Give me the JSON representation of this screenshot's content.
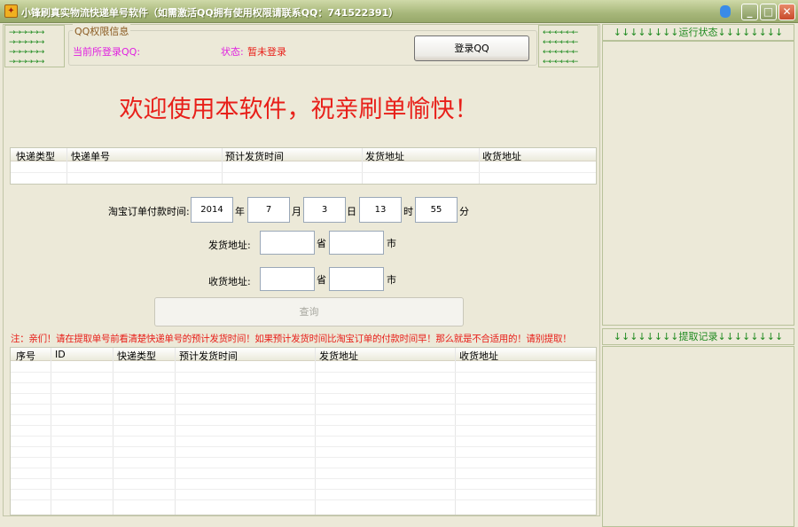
{
  "window": {
    "title": "小锋刷真实物流快递单号软件（如需激活QQ拥有使用权限请联系QQ：741522391）",
    "icon": "app-icon",
    "controls": [
      "help-icon",
      "minimize-icon",
      "maximize-icon",
      "close-icon"
    ]
  },
  "qq_group": {
    "title": "QQ权限信息",
    "current_qq_label": "当前所登录QQ:",
    "current_qq_value": "",
    "status_label": "状态:",
    "status_value": "暂未登录",
    "login_button": "登录QQ",
    "left_arrows": "→→→→→→",
    "right_arrows": "←←←←←←"
  },
  "welcome": "欢迎使用本软件，祝亲刷单愉快！",
  "order_table": {
    "columns": [
      "快递类型",
      "快递单号",
      "预计发货时间",
      "发货地址",
      "收货地址"
    ],
    "rows": []
  },
  "form": {
    "pay_time_label": "淘宝订单付款时间:",
    "year": "2014",
    "year_unit": "年",
    "month": "7",
    "month_unit": "月",
    "day": "3",
    "day_unit": "日",
    "hour": "13",
    "hour_unit": "时",
    "minute": "55",
    "minute_unit": "分",
    "ship_label": "发货地址:",
    "ship_province": "",
    "province_unit": "省",
    "ship_city": "",
    "city_unit": "市",
    "recv_label": "收货地址:",
    "recv_province": "",
    "recv_city": "",
    "query_button": "查询"
  },
  "note": "注：亲们！请在提取单号前看清楚快递单号的预计发货时间！如果预计发货时间比淘宝订单的付款时间早！那么就是不合适用的！请别提取！",
  "result_table": {
    "columns": [
      "序号",
      "ID",
      "快递类型",
      "预计发货时间",
      "发货地址",
      "收货地址"
    ],
    "rows": []
  },
  "right": {
    "status_title": "↓↓↓↓↓↓↓↓运行状态↓↓↓↓↓↓↓↓",
    "records_title": "↓↓↓↓↓↓↓↓提取记录↓↓↓↓↓↓↓↓"
  },
  "colors": {
    "welcome": "#e8201a",
    "note": "#e8201a",
    "status": "#e8201a",
    "qq_label": "#e020e0",
    "arrows": "#1f8a1f"
  }
}
